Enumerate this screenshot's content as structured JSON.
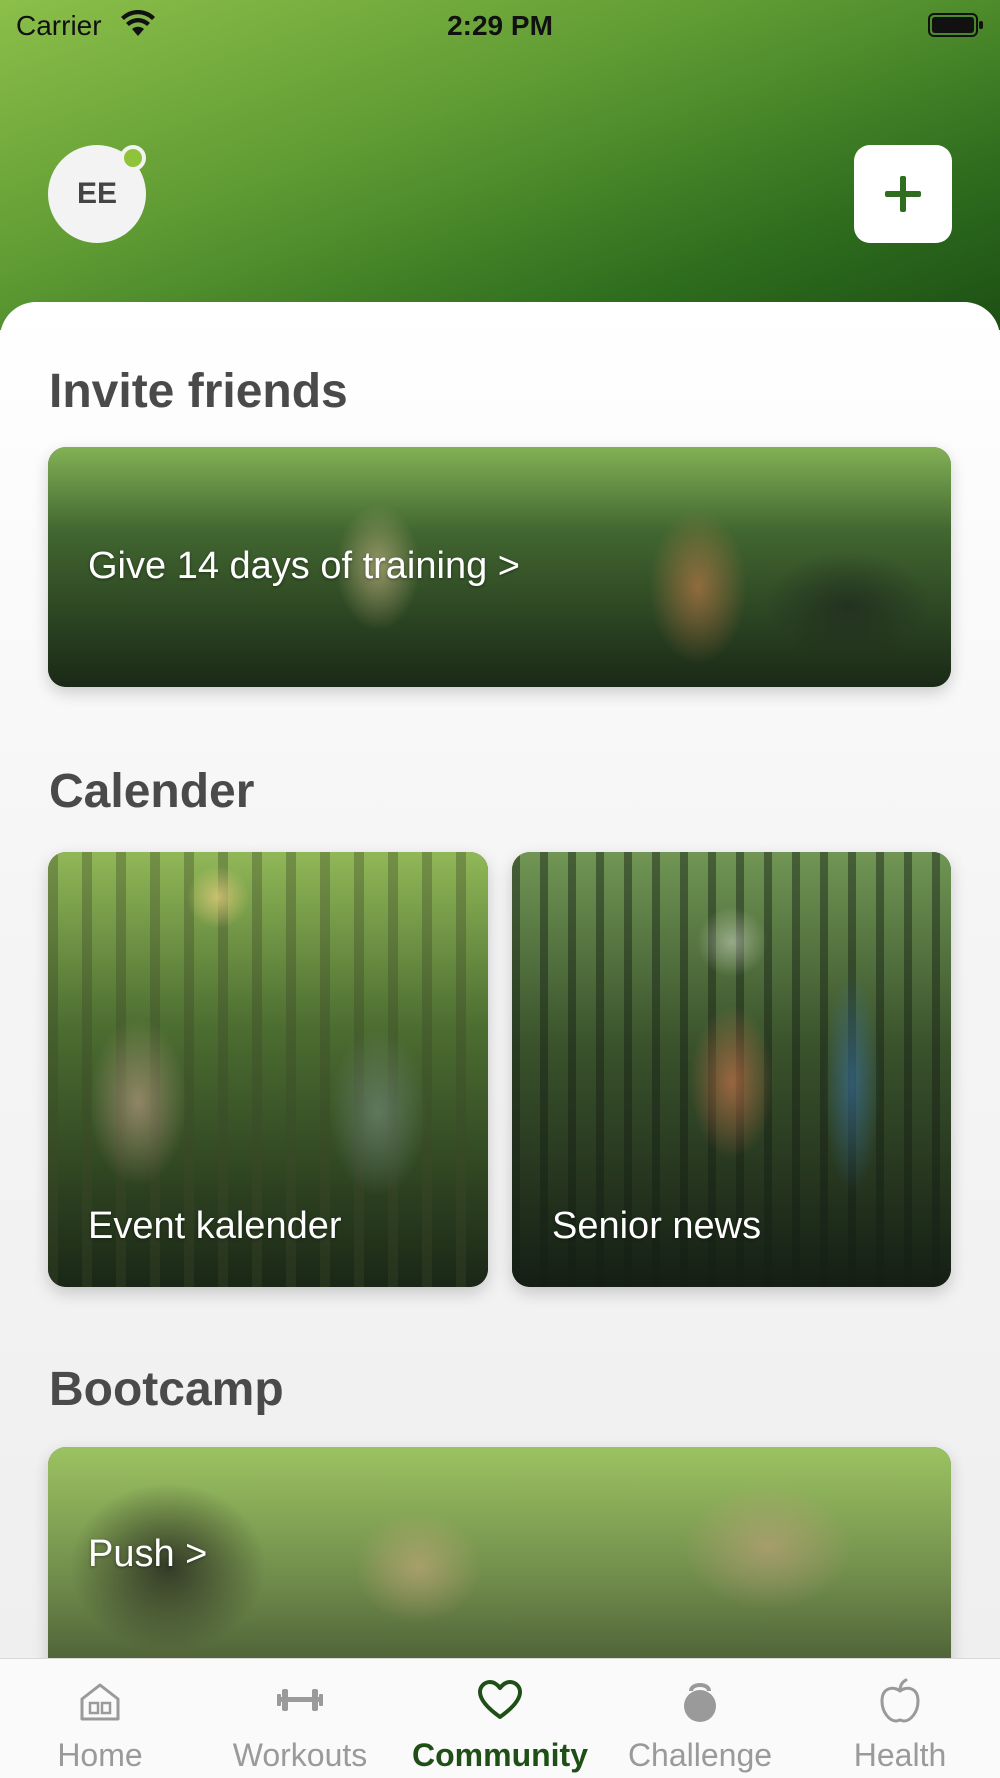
{
  "status_bar": {
    "carrier": "Carrier",
    "time": "2:29 PM"
  },
  "header": {
    "avatar_initials": "EE"
  },
  "sections": {
    "invite": {
      "title": "Invite friends",
      "card_label": "Give 14 days of training >"
    },
    "calendar": {
      "title": "Calender",
      "cards": [
        {
          "label": "Event kalender"
        },
        {
          "label": "Senior news"
        }
      ]
    },
    "bootcamp": {
      "title": "Bootcamp",
      "card_label": "Push >"
    }
  },
  "tabbar": {
    "tabs": [
      {
        "label": "Home",
        "icon": "home-icon"
      },
      {
        "label": "Workouts",
        "icon": "dumbbell-icon"
      },
      {
        "label": "Community",
        "icon": "heart-icon",
        "active": true
      },
      {
        "label": "Challenge",
        "icon": "kettlebell-icon"
      },
      {
        "label": "Health",
        "icon": "apple-icon"
      }
    ]
  },
  "colors": {
    "brand_dark_green": "#1f4f17",
    "header_light_green": "#8cbf4a",
    "online_dot": "#8fc43a",
    "inactive_tab": "#9a9a9a"
  }
}
